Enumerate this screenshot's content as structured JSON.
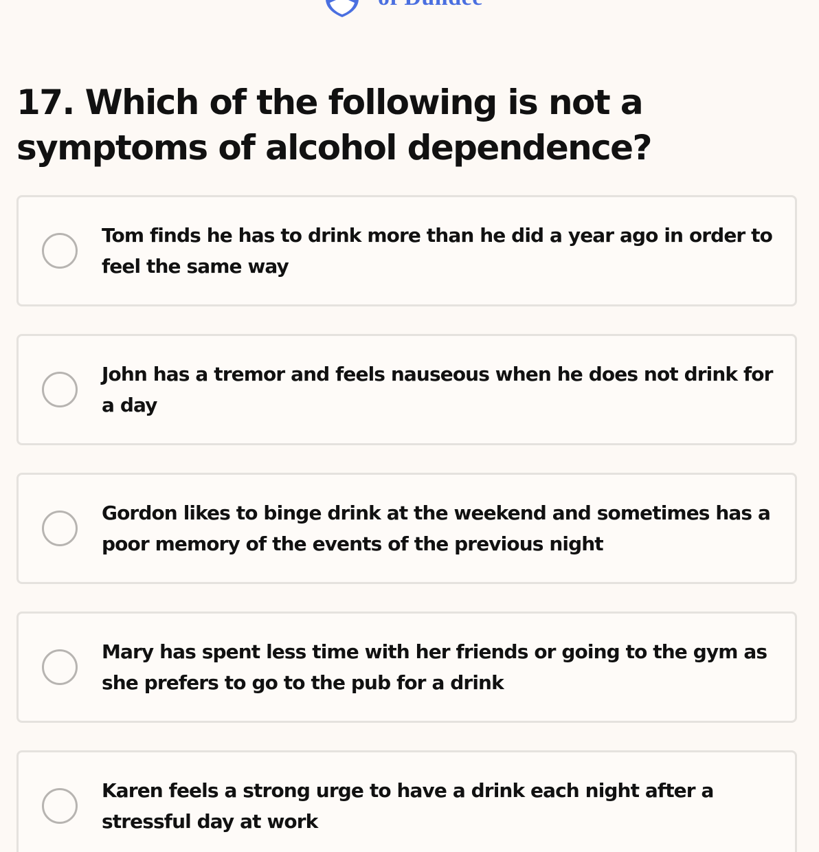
{
  "header": {
    "logo_text": "of Dundee",
    "logo_icon": "shield-logo-icon",
    "brand_color": "#4a6fe0"
  },
  "question": {
    "text": "17. Which of the following is not a symptoms of alcohol dependence?"
  },
  "options": [
    {
      "label": "Tom finds he has to drink more than he did a year ago in order to feel the same way",
      "selected": false
    },
    {
      "label": "John has a tremor and feels nauseous when he does not drink for a day",
      "selected": false
    },
    {
      "label": "Gordon likes to binge drink at the weekend and sometimes has a poor memory of the events of the previous night",
      "selected": false
    },
    {
      "label": "Mary has spent less time with her friends or going to the gym as she prefers to go to the pub for a drink",
      "selected": false
    },
    {
      "label": "Karen feels a strong urge to have a drink each night after a stressful day at work",
      "selected": false
    }
  ]
}
